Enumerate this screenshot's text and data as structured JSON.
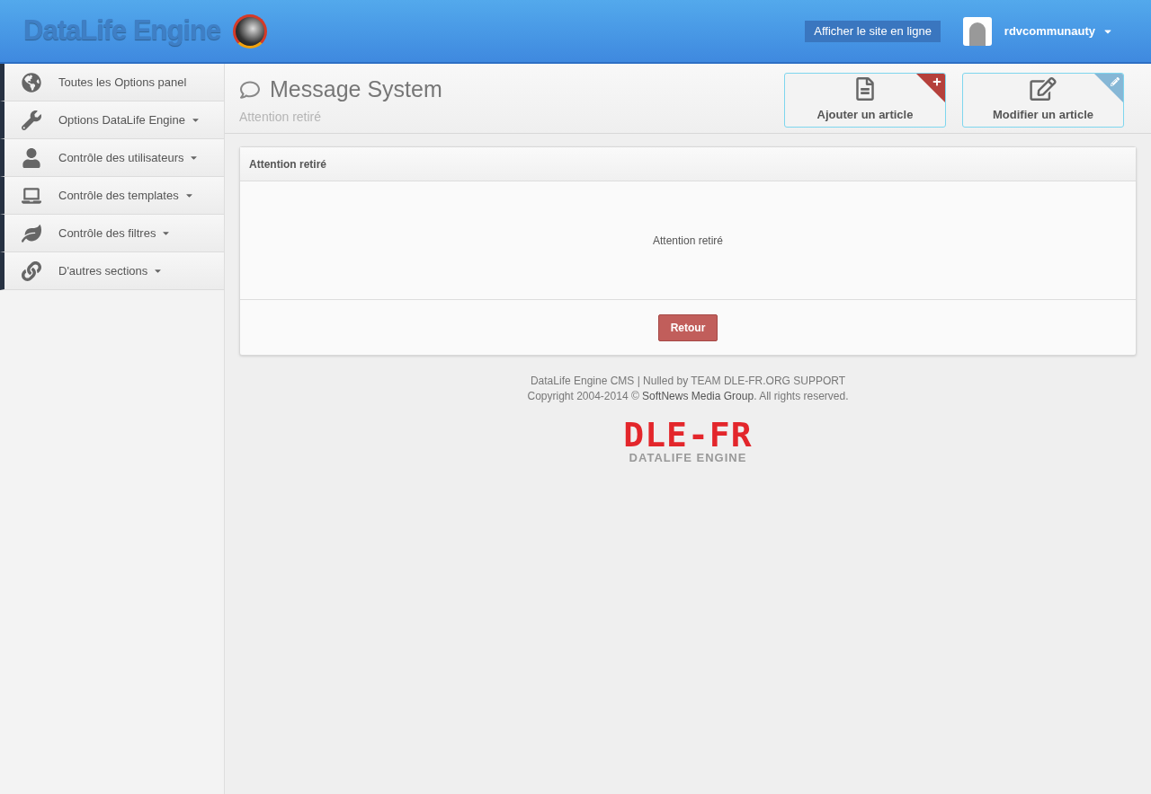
{
  "header": {
    "logo_text": "DataLife Engine",
    "view_site_button": "Afficher le site en ligne",
    "username": "rdvcommunauty"
  },
  "sidebar": {
    "items": [
      {
        "label": "Toutes les Options panel",
        "expandable": false
      },
      {
        "label": "Options DataLife Engine",
        "expandable": true
      },
      {
        "label": "Contrôle des utilisateurs",
        "expandable": true
      },
      {
        "label": "Contrôle des templates",
        "expandable": true
      },
      {
        "label": "Contrôle des filtres",
        "expandable": true
      },
      {
        "label": "D'autres sections",
        "expandable": true
      }
    ]
  },
  "page_header": {
    "title": "Message System",
    "subtitle": "Attention retiré",
    "actions": [
      {
        "label": "Ajouter un article",
        "kind": "add"
      },
      {
        "label": "Modifier un article",
        "kind": "edit"
      }
    ]
  },
  "panel": {
    "title": "Attention retiré",
    "message": "Attention retiré",
    "button": "Retour"
  },
  "footer": {
    "line1": "DataLife Engine CMS | Nulled by TEAM DLE-FR.ORG SUPPORT",
    "copyright_before": "Copyright 2004-2014 © ",
    "copyright_link": "SoftNews Media Group",
    "copyright_after": ". All rights reserved.",
    "logo_title": "DLE-FR",
    "logo_subtitle": "DATALIFE ENGINE"
  }
}
